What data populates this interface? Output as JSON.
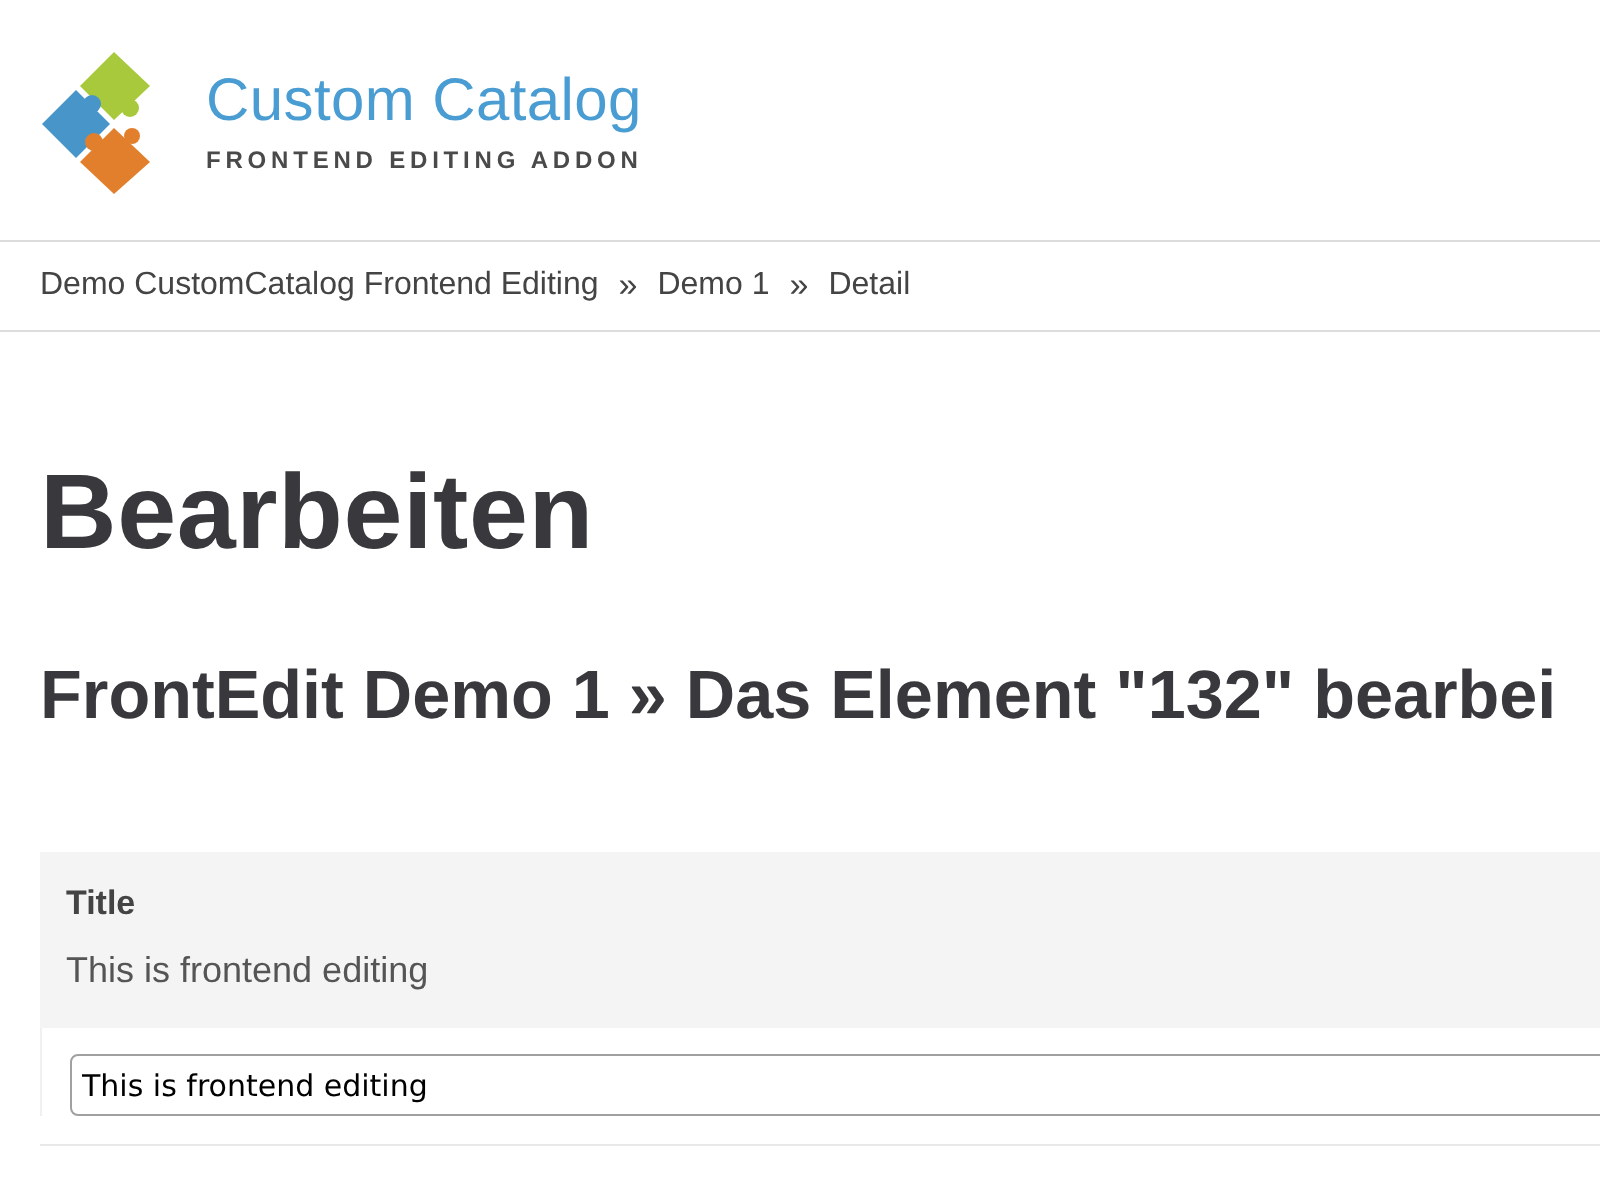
{
  "header": {
    "logo": {
      "title": "Custom Catalog",
      "subtitle": "FRONTEND EDITING ADDON"
    }
  },
  "breadcrumb": [
    {
      "kind": "link",
      "text": "Demo CustomCatalog Frontend Editing"
    },
    {
      "kind": "separator",
      "text": "»"
    },
    {
      "kind": "link",
      "text": "Demo 1"
    },
    {
      "kind": "separator",
      "text": "»"
    },
    {
      "kind": "link",
      "text": "Detail"
    }
  ],
  "page_title": "Bearbeiten",
  "subtitle": "FrontEdit Demo 1 » Das Element \"132\" bearbei",
  "form": {
    "fields": [
      {
        "label": "Title",
        "current_value": "This is frontend editing",
        "input": {
          "value": "This is frontend editing"
        }
      }
    ]
  }
}
